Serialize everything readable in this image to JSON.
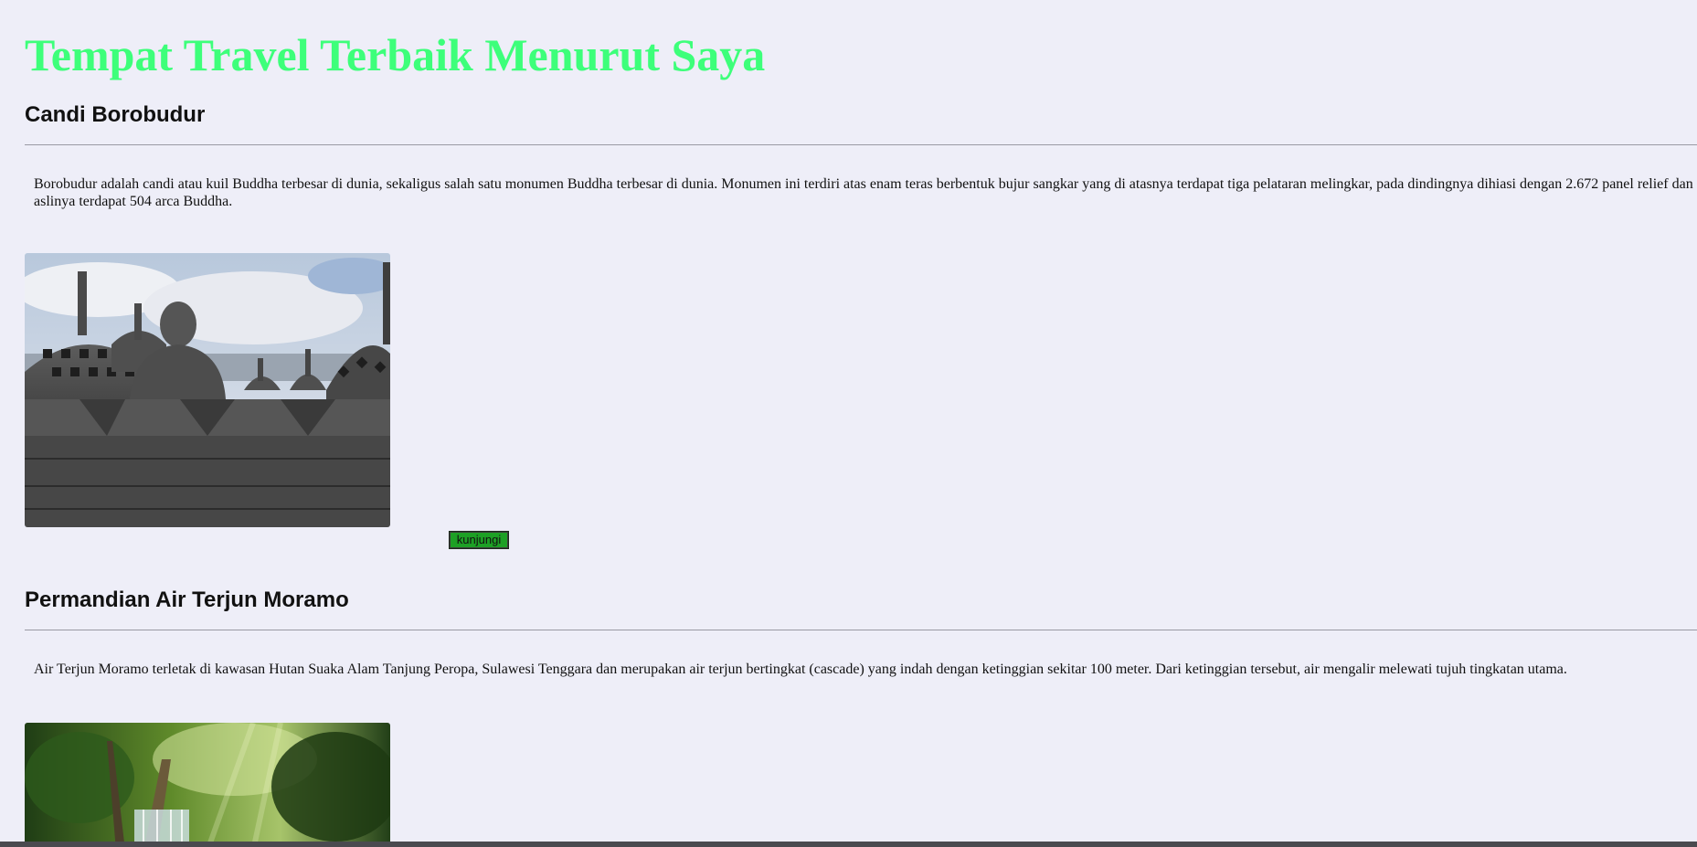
{
  "page": {
    "title": "Tempat Travel Terbaik Menurut Saya"
  },
  "destinations": [
    {
      "heading": "Candi Borobudur",
      "description": "Borobudur adalah candi atau kuil Buddha terbesar di dunia, sekaligus salah satu monumen Buddha terbesar di dunia. Monumen ini terdiri atas enam teras berbentuk bujur sangkar yang di atasnya terdapat tiga pelataran melingkar, pada dindingnya dihiasi dengan 2.672 panel relief dan aslinya terdapat 504 arca Buddha.",
      "image_subject": "borobudur-stupas-buddha-photo",
      "button_label": "kunjungi"
    },
    {
      "heading": "Permandian Air Terjun Moramo",
      "description": "Air Terjun Moramo terletak di kawasan Hutan Suaka Alam Tanjung Peropa, Sulawesi Tenggara dan merupakan air terjun bertingkat (cascade) yang indah dengan ketinggian sekitar 100 meter. Dari ketinggian tersebut, air mengalir melewati tujuh tingkatan utama.",
      "image_subject": "moramo-waterfall-forest-photo"
    }
  ],
  "colors": {
    "background": "#eeeef8",
    "title": "#3dff7a",
    "button": "#1da025"
  }
}
